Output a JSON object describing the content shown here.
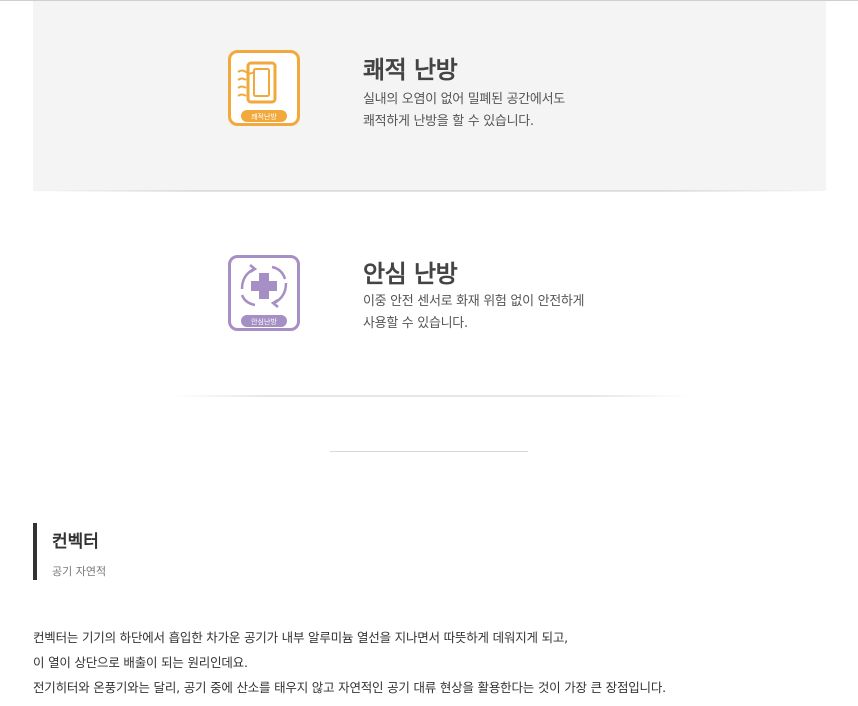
{
  "features": [
    {
      "icon": "warm-air-heater-icon",
      "icon_label": "쾌적난방",
      "accent": "#f2a93b",
      "title": "쾌적 난방",
      "desc_lines": [
        "실내의 오염이 없어 밀폐된 공간에서도",
        "쾌적하게 난방을 할 수 있습니다."
      ]
    },
    {
      "icon": "safety-cross-arrows-icon",
      "icon_label": "안심난방",
      "accent": "#a68fc4",
      "title": "안심 난방",
      "desc_lines": [
        "이중 안전 센서로 화재 위험 없이 안전하게",
        "사용할 수 있습니다."
      ]
    }
  ],
  "section": {
    "title": "컨벡터",
    "subtitle": "공기 자연적"
  },
  "body": {
    "lines": [
      "컨벡터는 기기의 하단에서 흡입한 차가운 공기가 내부 알루미늄 열선을 지나면서 따뜻하게 데워지게 되고,",
      "이 열이 상단으로 배출이 되는 원리인데요.",
      "전기히터와 온풍기와는 달리, 공기 중에 산소를 태우지 않고 자연적인 공기 대류 현상을 활용한다는 것이 가장 큰 장점입니다."
    ]
  }
}
